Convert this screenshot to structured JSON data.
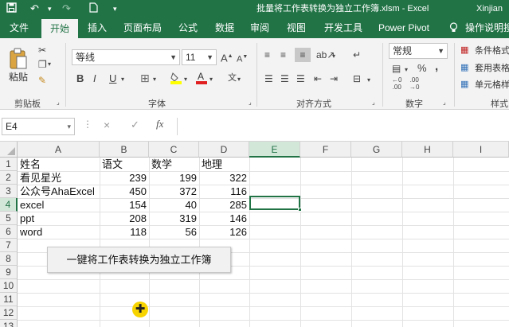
{
  "window": {
    "title": "批量将工作表转换为独立工作簿.xlsm  -  Excel",
    "user": "Xinjian"
  },
  "quick_access": {
    "save_icon": "save-icon",
    "undo_icon": "undo-icon",
    "redo_icon": "redo-icon",
    "new_icon": "new-file-icon"
  },
  "tabs": [
    {
      "label": "文件"
    },
    {
      "label": "开始"
    },
    {
      "label": "插入"
    },
    {
      "label": "页面布局"
    },
    {
      "label": "公式"
    },
    {
      "label": "数据"
    },
    {
      "label": "审阅"
    },
    {
      "label": "视图"
    },
    {
      "label": "开发工具"
    },
    {
      "label": "Power Pivot"
    },
    {
      "label": "操作说明搜"
    }
  ],
  "active_tab": "开始",
  "ribbon": {
    "clipboard": {
      "paste_label": "粘贴",
      "group_label": "剪贴板"
    },
    "font": {
      "font_name": "等线",
      "font_size": "11",
      "group_label": "字体",
      "bold": "B",
      "italic": "I",
      "underline": "U"
    },
    "alignment": {
      "group_label": "对齐方式"
    },
    "number": {
      "format": "常规",
      "group_label": "数字",
      "percent": "%",
      "comma": ","
    },
    "styles": {
      "conditional": "条件格式",
      "table": "套用表格",
      "cell": "单元格样",
      "group_label": "样式"
    }
  },
  "formula_bar": {
    "name_box": "E4",
    "fx": "fx",
    "cancel": "×",
    "confirm": "✓",
    "content": ""
  },
  "sheet": {
    "columns": [
      "A",
      "B",
      "C",
      "D",
      "E",
      "F",
      "G",
      "H",
      "I"
    ],
    "selected_column": "E",
    "rows": [
      "1",
      "2",
      "3",
      "4",
      "5",
      "6",
      "7",
      "8",
      "9",
      "10",
      "11",
      "12",
      "13"
    ],
    "selected_row": "4",
    "active_cell": "E4",
    "headers": [
      "姓名",
      "语文",
      "数学",
      "地理"
    ],
    "data": [
      {
        "name": "看见星光",
        "chinese": "239",
        "math": "199",
        "geo": "322"
      },
      {
        "name": "公众号AhaExcel",
        "chinese": "450",
        "math": "372",
        "geo": "116"
      },
      {
        "name": "excel",
        "chinese": "154",
        "math": "40",
        "geo": "285"
      },
      {
        "name": "ppt",
        "chinese": "208",
        "math": "319",
        "geo": "146"
      },
      {
        "name": "word",
        "chinese": "118",
        "math": "56",
        "geo": "126"
      }
    ],
    "button_label": "一键将工作表转换为独立工作簿"
  },
  "colors": {
    "accent": "#217346",
    "cursor_highlight": "#f7d400"
  }
}
